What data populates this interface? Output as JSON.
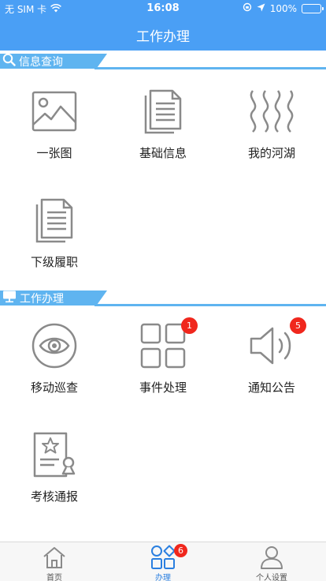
{
  "status_bar": {
    "carrier": "无 SIM 卡",
    "time": "16:08",
    "battery": "100%",
    "battery_level": 1.0
  },
  "nav": {
    "title": "工作办理"
  },
  "sections": [
    {
      "title": "信息查询",
      "items": [
        {
          "label": "一张图",
          "icon": "image-icon"
        },
        {
          "label": "基础信息",
          "icon": "document-icon"
        },
        {
          "label": "我的河湖",
          "icon": "river-icon"
        },
        {
          "label": "下级履职",
          "icon": "document-icon"
        }
      ]
    },
    {
      "title": "工作办理",
      "items": [
        {
          "label": "移动巡查",
          "icon": "eye-icon"
        },
        {
          "label": "事件处理",
          "icon": "grid-icon",
          "badge": "1"
        },
        {
          "label": "通知公告",
          "icon": "speaker-icon",
          "badge": "5"
        },
        {
          "label": "考核通报",
          "icon": "certificate-icon"
        }
      ]
    }
  ],
  "tabs": [
    {
      "label": "首页",
      "icon": "home-icon"
    },
    {
      "label": "办理",
      "icon": "shapes-icon",
      "badge": "6",
      "active": true
    },
    {
      "label": "个人设置",
      "icon": "user-icon"
    }
  ],
  "colors": {
    "primary": "#4a9ff5",
    "section": "#5fb4f0",
    "badge": "#f0271d",
    "icon_stroke": "#8a8a8a"
  }
}
